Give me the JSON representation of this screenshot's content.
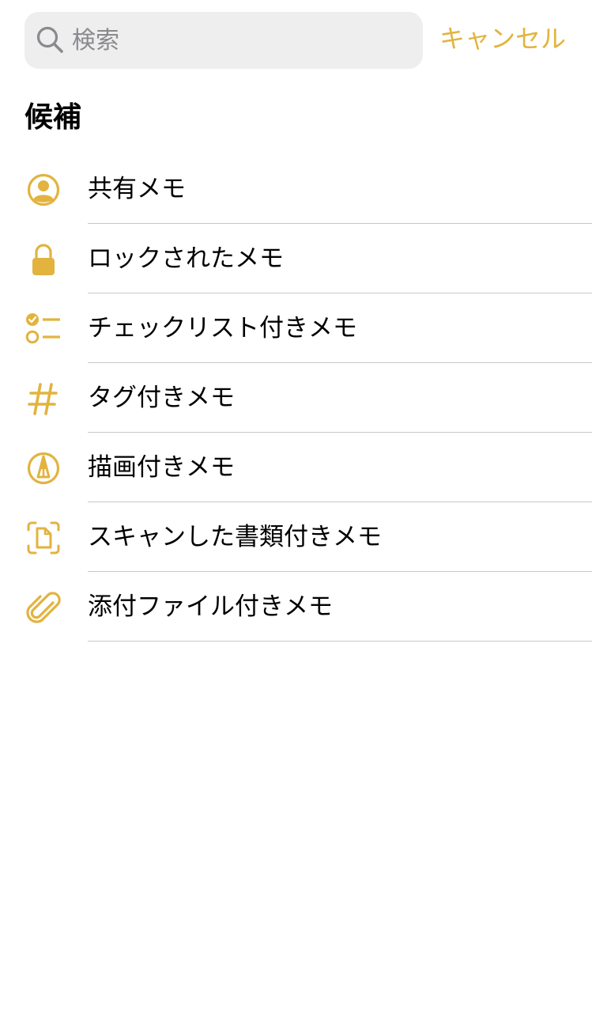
{
  "search": {
    "placeholder": "検索",
    "value": "",
    "cancel_label": "キャンセル"
  },
  "section": {
    "title": "候補"
  },
  "suggestions": [
    {
      "label": "共有メモ",
      "icon": "person-circle-icon"
    },
    {
      "label": "ロックされたメモ",
      "icon": "lock-icon"
    },
    {
      "label": "チェックリスト付きメモ",
      "icon": "checklist-icon"
    },
    {
      "label": "タグ付きメモ",
      "icon": "hashtag-icon"
    },
    {
      "label": "描画付きメモ",
      "icon": "pen-tip-circle-icon"
    },
    {
      "label": "スキャンした書類付きメモ",
      "icon": "document-scan-icon"
    },
    {
      "label": "添付ファイル付きメモ",
      "icon": "paperclip-icon"
    }
  ],
  "colors": {
    "accent": "#e2b33f",
    "search_background": "#eeeeef",
    "placeholder": "#8a8a8e",
    "divider": "#c8c8cc"
  }
}
